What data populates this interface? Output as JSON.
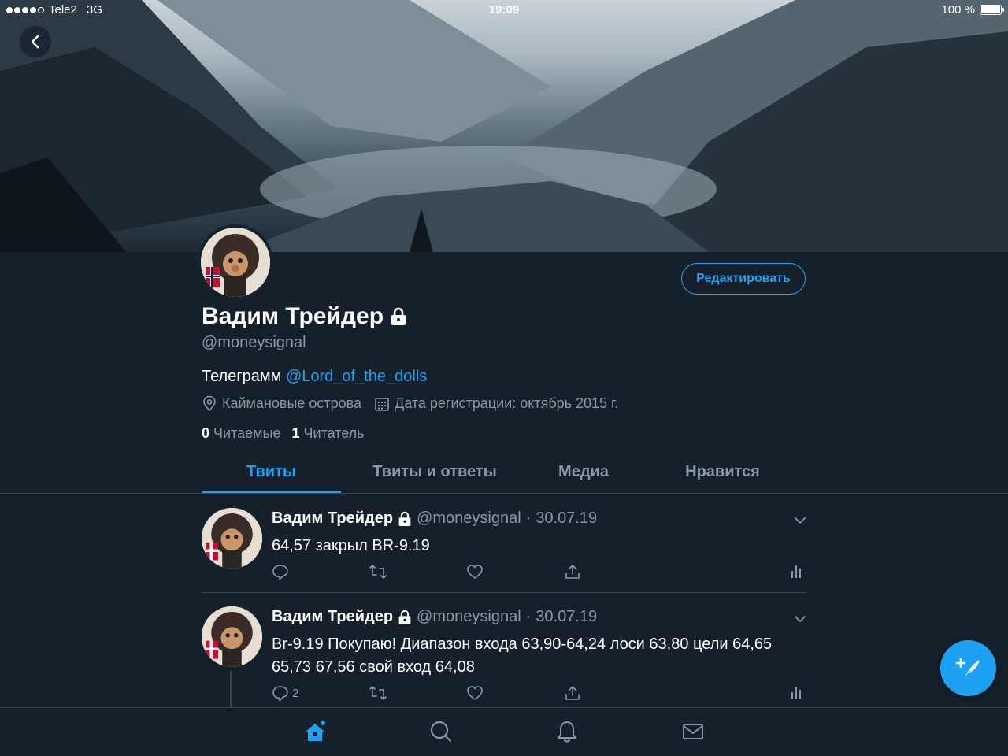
{
  "status_bar": {
    "carrier": "Tele2",
    "network": "3G",
    "time": "19:09",
    "battery": "100 %"
  },
  "profile": {
    "display_name": "Вадим Трейдер",
    "handle": "@moneysignal",
    "bio_text": "Телеграмм ",
    "bio_link": "@Lord_of_the_dolls",
    "location": "Каймановые острова",
    "joined": "Дата регистрации: октябрь 2015 г.",
    "following_count": "0",
    "following_label": "Читаемые",
    "followers_count": "1",
    "followers_label": "Читатель",
    "edit_button": "Редактировать"
  },
  "tabs": [
    {
      "label": "Твиты",
      "active": true
    },
    {
      "label": "Твиты и ответы",
      "active": false
    },
    {
      "label": "Медиа",
      "active": false
    },
    {
      "label": "Нравится",
      "active": false
    }
  ],
  "tweets": [
    {
      "name": "Вадим Трейдер",
      "handle": "@moneysignal",
      "sep": "·",
      "date": "30.07.19",
      "text": "64,57 закрыл BR-9.19",
      "reply_count": ""
    },
    {
      "name": "Вадим Трейдер",
      "handle": "@moneysignal",
      "sep": "·",
      "date": "30.07.19",
      "text": "Br-9.19 Покупаю! Диапазон входа 63,90-64,24 лоси 63,80 цели 64,65 65,73 67,56 свой вход 64,08",
      "reply_count": "2"
    }
  ],
  "colors": {
    "background": "#15202b",
    "accent": "#1da1f2",
    "muted": "#8899a6",
    "divider": "#38444d"
  },
  "icons": [
    "back-icon",
    "lock-icon",
    "location-icon",
    "calendar-icon",
    "reply-icon",
    "retweet-icon",
    "like-icon",
    "share-icon",
    "analytics-icon",
    "chevron-down-icon",
    "compose-icon",
    "home-icon",
    "search-icon",
    "notifications-icon",
    "messages-icon"
  ]
}
